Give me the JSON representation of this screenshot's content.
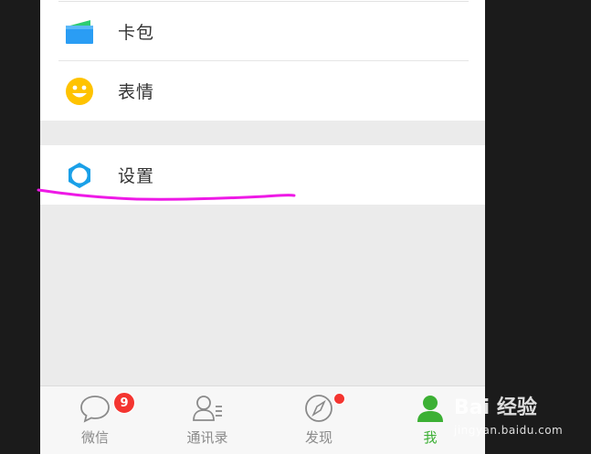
{
  "menu": {
    "items_top": [
      {
        "label": "卡包",
        "icon": "card-wallet-icon"
      },
      {
        "label": "表情",
        "icon": "smiley-icon"
      }
    ],
    "settings": {
      "label": "设置",
      "icon": "gear-icon"
    }
  },
  "tabbar": {
    "tabs": [
      {
        "label": "微信",
        "icon": "chat-bubble-icon",
        "badge": "9"
      },
      {
        "label": "通讯录",
        "icon": "contacts-icon"
      },
      {
        "label": "发现",
        "icon": "compass-icon"
      },
      {
        "label": "我",
        "icon": "person-icon"
      }
    ],
    "active_index": 3
  },
  "colors": {
    "accent_green": "#3cb034",
    "badge_red": "#f43530",
    "settings_blue": "#1aa0e8",
    "highlight_magenta": "#ee19e6"
  },
  "watermark": {
    "brand": "Bai 经验",
    "url": "jingyan.baidu.com"
  }
}
